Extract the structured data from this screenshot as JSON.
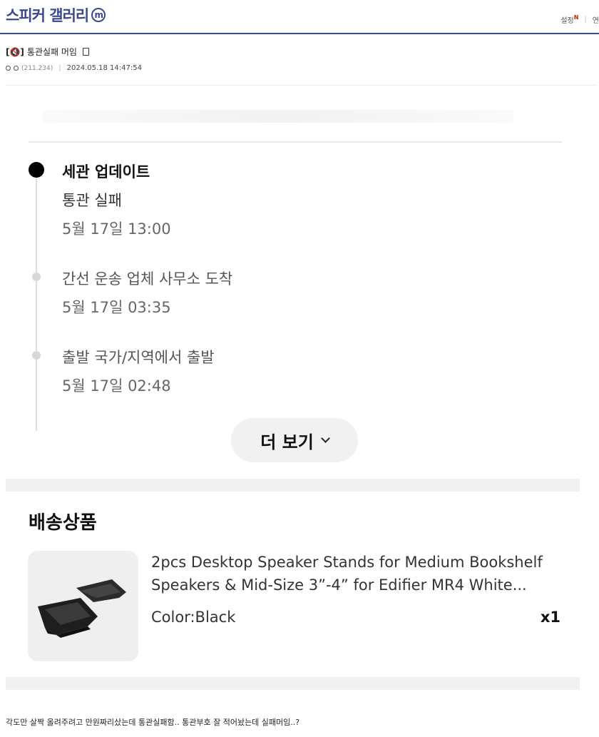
{
  "gallery": {
    "title": "스피커 갤러리",
    "badge": "m",
    "settings_label": "설정",
    "new_mark": "N",
    "right_cut_label": "연"
  },
  "post": {
    "category": "[🔇]",
    "title": "통관실패 머임",
    "author_ip": "(211.234)",
    "datetime": "2024.05.18 14:47:54"
  },
  "tracking": {
    "events": [
      {
        "title": "세관 업데이트",
        "detail": "통관 실패",
        "date": "5월 17일 13:00",
        "current": true
      },
      {
        "title": "간선 운송 업체 사무소 도착",
        "date": "5월 17일 03:35",
        "current": false
      },
      {
        "title": "출발 국가/지역에서 출발",
        "date": "5월 17일 02:48",
        "current": false
      }
    ],
    "more_label": "더 보기"
  },
  "shipment": {
    "section_title": "배송상품",
    "product": {
      "name_line1": "2pcs Desktop Speaker Stands for Medium Bookshelf",
      "name_line2": "Speakers & Mid-Size 3”-4” for Edifier MR4 White...",
      "color": "Color:Black",
      "quantity": "x1"
    }
  },
  "body_text": "각도만 살짝 올려주려고 만원짜리샀는데 통관실패함.. 통관부호 잘 적어놨는데 실패머임..?",
  "colors": {
    "brand": "#3b4890",
    "new_mark": "#d31900",
    "timeline_active": "#000000",
    "timeline_inactive": "#d8d8d8"
  }
}
